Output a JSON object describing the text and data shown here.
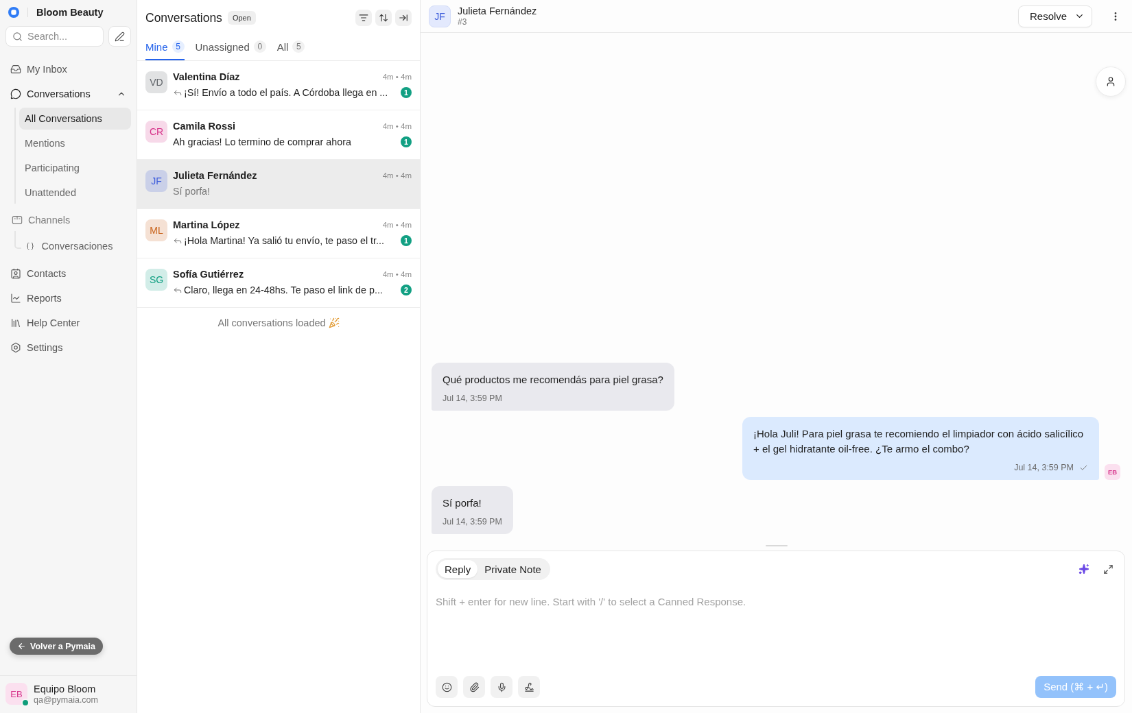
{
  "sidebar": {
    "brand": "Bloom Beauty",
    "search": {
      "placeholder": "Search..."
    },
    "nav": [
      {
        "kind": "link",
        "label": "My Inbox",
        "selected": false
      },
      {
        "kind": "group",
        "label": "Conversations",
        "selected": false,
        "expanded": true,
        "children": [
          {
            "label": "All Conversations",
            "selected": true
          },
          {
            "label": "Mentions",
            "selected": false
          },
          {
            "label": "Participating",
            "selected": false
          },
          {
            "label": "Unattended",
            "selected": false
          }
        ]
      },
      {
        "kind": "section",
        "label": "Channels",
        "selected": false,
        "children": [
          {
            "label": "Conversaciones",
            "selected": false
          }
        ]
      },
      {
        "kind": "link",
        "label": "Contacts",
        "selected": false
      },
      {
        "kind": "link",
        "label": "Reports",
        "selected": false
      },
      {
        "kind": "link",
        "label": "Help Center",
        "selected": false
      },
      {
        "kind": "link",
        "label": "Settings",
        "selected": false
      }
    ],
    "back_button": "Volver a Pymaia",
    "user": {
      "initials": "EB",
      "name": "Equipo Bloom",
      "email": "qa@pymaia.com",
      "online": true
    }
  },
  "conversation_list": {
    "title": "Conversations",
    "status": "Open",
    "tabs": [
      {
        "label": "Mine",
        "count": "5",
        "selected": true
      },
      {
        "label": "Unassigned",
        "count": "0",
        "selected": false
      },
      {
        "label": "All",
        "count": "5",
        "selected": false
      }
    ],
    "items": [
      {
        "initials": "VD",
        "color": "#5f6368",
        "name": "Valentina Díaz",
        "time": "4m • 4m",
        "preview": "¡Sí! Envío a todo el país. A Córdoba llega en ...",
        "replied": true,
        "unread": "1",
        "selected": false
      },
      {
        "initials": "CR",
        "color": "#d6338a",
        "name": "Camila Rossi",
        "time": "4m • 4m",
        "preview": "Ah gracias! Lo termino de comprar ahora",
        "replied": false,
        "unread": "1",
        "selected": false
      },
      {
        "initials": "JF",
        "color": "#3b5bdb",
        "name": "Julieta Fernández",
        "time": "4m • 4m",
        "preview": "Sí porfa!",
        "replied": false,
        "selected": true
      },
      {
        "initials": "ML",
        "color": "#c8621a",
        "name": "Martina López",
        "time": "4m • 4m",
        "preview": "¡Hola Martina! Ya salió tu envío, te paso el tr...",
        "replied": true,
        "unread": "1",
        "selected": false
      },
      {
        "initials": "SG",
        "color": "#12a083",
        "name": "Sofía Gutiérrez",
        "time": "4m • 4m",
        "preview": "Claro, llega en 24-48hs. Te paso el link de p...",
        "replied": true,
        "unread": "2",
        "selected": false
      }
    ],
    "footer": "All conversations loaded"
  },
  "chat": {
    "contact": {
      "initials": "JF",
      "name": "Julieta Fernández",
      "number": "#3"
    },
    "resolve_button": "Resolve",
    "messages": [
      {
        "kind": "incoming",
        "text": "Qué productos me recomendás para piel grasa?",
        "time": "Jul 14, 3:59 PM"
      },
      {
        "kind": "outgoing",
        "text": "¡Hola Juli! Para piel grasa te recomiendo el limpiador con ácido salicílico + el gel hidratante oil-free. ¿Te armo el combo?",
        "time": "Jul 14, 3:59 PM",
        "sent": true,
        "sender_initials": "EB"
      },
      {
        "kind": "incoming",
        "text": "Sí porfa!",
        "time": "Jul 14, 3:59 PM"
      }
    ],
    "composer": {
      "modes": [
        {
          "label": "Reply",
          "selected": true
        },
        {
          "label": "Private Note",
          "selected": false
        }
      ],
      "placeholder": "Shift + enter for new line. Start with '/' to select a Canned Response.",
      "send_button": {
        "label": "Send (⌘ + ↵)",
        "disabled": true
      }
    }
  }
}
